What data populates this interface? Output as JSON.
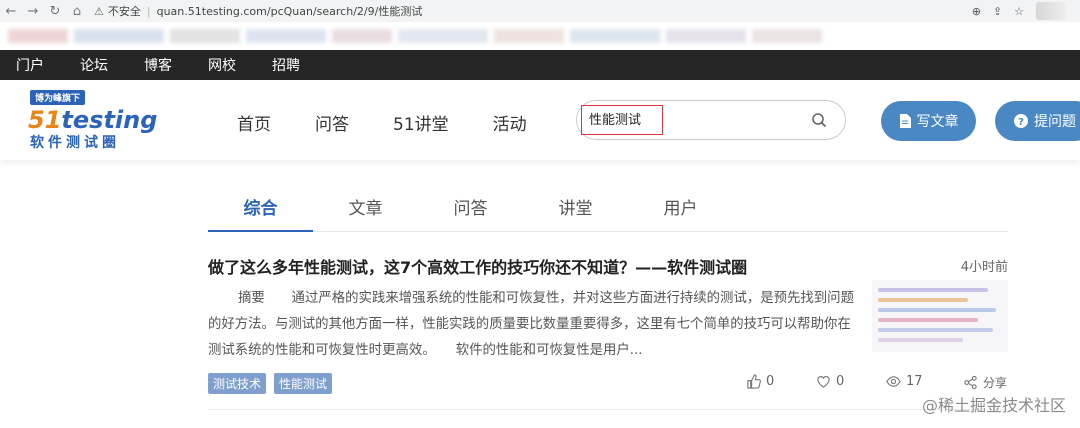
{
  "browser": {
    "security_label": "不安全",
    "url": "quan.51testing.com/pcQuan/search/2/9/性能测试"
  },
  "topbar": {
    "items": [
      "门户",
      "论坛",
      "博客",
      "网校",
      "招聘"
    ]
  },
  "logo": {
    "tag": "博为峰旗下",
    "brand_a": "51",
    "brand_b": "testing",
    "chinese": "软件测试圈"
  },
  "nav": {
    "items": [
      "首页",
      "问答",
      "51讲堂",
      "活动"
    ]
  },
  "search": {
    "value": "性能测试"
  },
  "buttons": {
    "write": "写文章",
    "ask": "提问题"
  },
  "tabs": [
    "综合",
    "文章",
    "问答",
    "讲堂",
    "用户"
  ],
  "article": {
    "title": "做了这么多年性能测试，这7个高效工作的技巧你还不知道？——软件测试圈",
    "time": "4小时前",
    "summary": "摘要　　通过严格的实践来增强系统的性能和可恢复性，并对这些方面进行持续的测试，是预先找到问题的好方法。与测试的其他方面一样，性能实践的质量要比数量重要得多，这里有七个简单的技巧可以帮助你在测试系统的性能和可恢复性时更高效。　　软件的性能和可恢复性是用户...",
    "tags": [
      "测试技术",
      "性能测试"
    ],
    "likes": "0",
    "favorites": "0",
    "views": "17",
    "share": "分享"
  },
  "watermark": "@稀土掘金技术社区",
  "colors": {
    "accent": "#2b63b8",
    "button": "#4a88c4",
    "highlight": "#d9393e",
    "topbar": "#262626"
  }
}
